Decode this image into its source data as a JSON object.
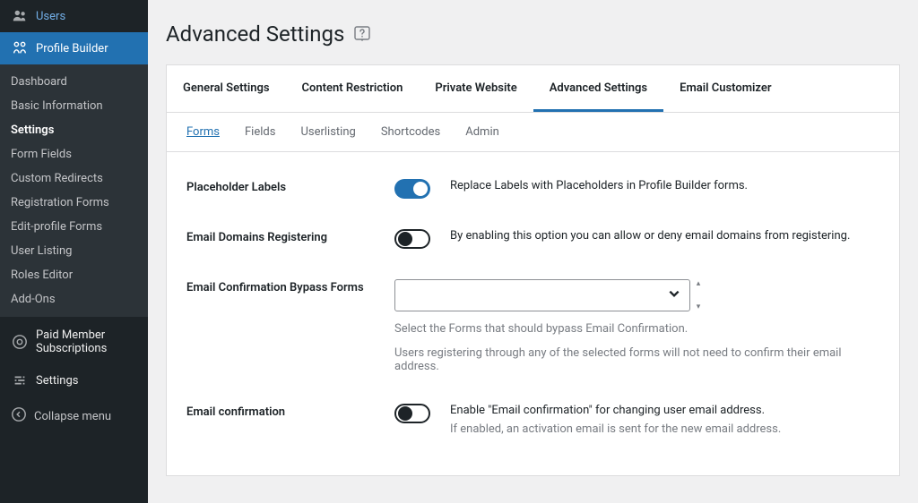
{
  "sidebar": {
    "top_items": [
      {
        "id": "users",
        "label": "Users",
        "icon": "users-icon"
      },
      {
        "id": "profile-builder",
        "label": "Profile Builder",
        "icon": "pb-icon",
        "active": true
      }
    ],
    "sub_items": [
      {
        "label": "Dashboard"
      },
      {
        "label": "Basic Information"
      },
      {
        "label": "Settings",
        "active": true
      },
      {
        "label": "Form Fields"
      },
      {
        "label": "Custom Redirects"
      },
      {
        "label": "Registration Forms"
      },
      {
        "label": "Edit-profile Forms"
      },
      {
        "label": "User Listing"
      },
      {
        "label": "Roles Editor"
      },
      {
        "label": "Add-Ons"
      }
    ],
    "lower_items": [
      {
        "id": "paid-member",
        "label": "Paid Member Subscriptions",
        "icon": "pms-icon"
      },
      {
        "id": "settings",
        "label": "Settings",
        "icon": "settings-icon"
      }
    ],
    "collapse_label": "Collapse menu"
  },
  "page": {
    "title": "Advanced Settings"
  },
  "tabs": {
    "primary": [
      {
        "label": "General Settings"
      },
      {
        "label": "Content Restriction"
      },
      {
        "label": "Private Website"
      },
      {
        "label": "Advanced Settings",
        "active": true
      },
      {
        "label": "Email Customizer"
      }
    ],
    "secondary": [
      {
        "label": "Forms",
        "active": true
      },
      {
        "label": "Fields"
      },
      {
        "label": "Userlisting"
      },
      {
        "label": "Shortcodes"
      },
      {
        "label": "Admin"
      }
    ]
  },
  "settings": {
    "placeholder_labels": {
      "label": "Placeholder Labels",
      "on": true,
      "desc": "Replace Labels with Placeholders in Profile Builder forms."
    },
    "email_domains": {
      "label": "Email Domains Registering",
      "on": false,
      "desc": "By enabling this option you can allow or deny email domains from registering."
    },
    "email_bypass": {
      "label": "Email Confirmation Bypass Forms",
      "help1": "Select the Forms that should bypass Email Confirmation.",
      "help2": "Users registering through any of the selected forms will not need to confirm their email address."
    },
    "email_confirmation": {
      "label": "Email confirmation",
      "on": false,
      "desc": "Enable \"Email confirmation\" for changing user email address.",
      "help": "If enabled, an activation email is sent for the new email address."
    }
  }
}
